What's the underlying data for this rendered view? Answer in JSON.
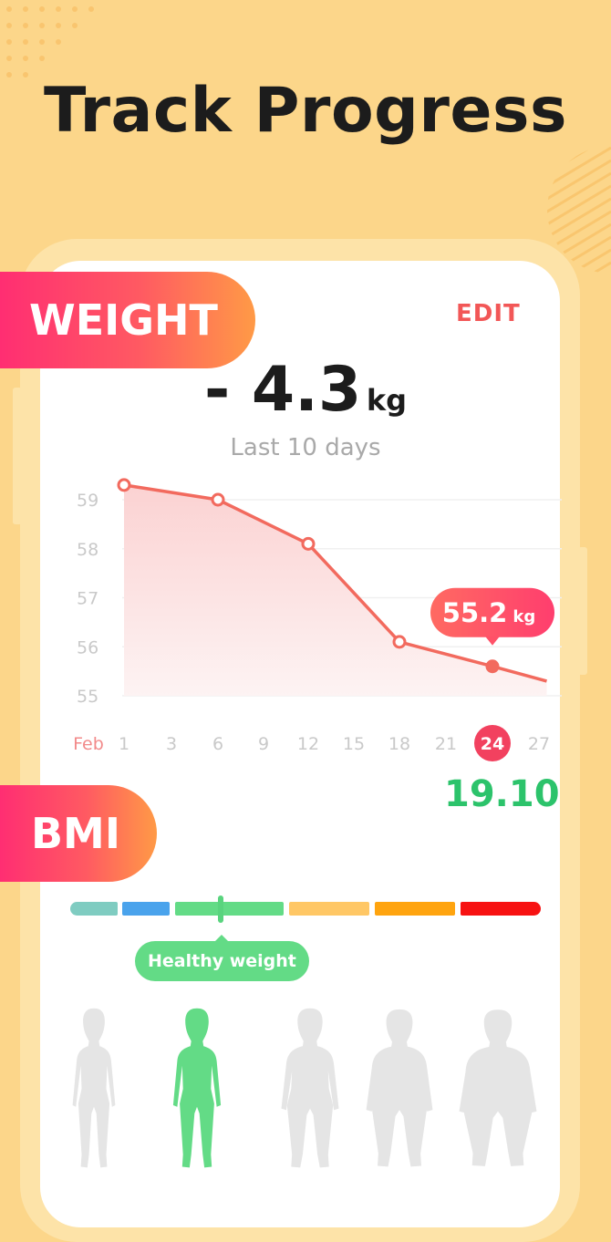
{
  "headline": "Track Progress",
  "weight": {
    "label": "WEIGHT",
    "edit_label": "EDIT",
    "change_value": "- 4.3",
    "change_unit": "kg",
    "period": "Last 10 days"
  },
  "chart_data": {
    "type": "area",
    "month_label": "Feb",
    "x_ticks": [
      1,
      3,
      6,
      9,
      12,
      15,
      18,
      21,
      24,
      27
    ],
    "y_ticks": [
      59,
      58,
      57,
      56,
      55
    ],
    "ylim": [
      55,
      59
    ],
    "points": [
      {
        "day": 1,
        "kg": 59.3
      },
      {
        "day": 6,
        "kg": 59.0
      },
      {
        "day": 12,
        "kg": 58.1
      },
      {
        "day": 18,
        "kg": 56.1
      },
      {
        "day": 24,
        "kg": 55.6
      }
    ],
    "trailing_end": {
      "day": 27.5,
      "kg": 55.3
    },
    "selected_day": 24,
    "selected_value": "55.2",
    "selected_unit": "kg",
    "line_color": "#F26A5E",
    "highlight_color": "#F2415F"
  },
  "bmi": {
    "label": "BMI",
    "value": "19.10",
    "value_color": "#2CC36B",
    "category": "Healthy weight",
    "scale_segments": [
      {
        "color": "#7FCCC1"
      },
      {
        "color": "#4AA3EC"
      },
      {
        "color": "#63DB86"
      },
      {
        "color": "#FFC765"
      },
      {
        "color": "#FFA40F"
      },
      {
        "color": "#F71212"
      }
    ],
    "marker_value": 19.1,
    "body_types": [
      "underweight-body-icon",
      "healthy-body-icon",
      "overweight-body-icon",
      "obese-body-icon",
      "extremely-obese-body-icon"
    ],
    "active_body_index": 1
  }
}
